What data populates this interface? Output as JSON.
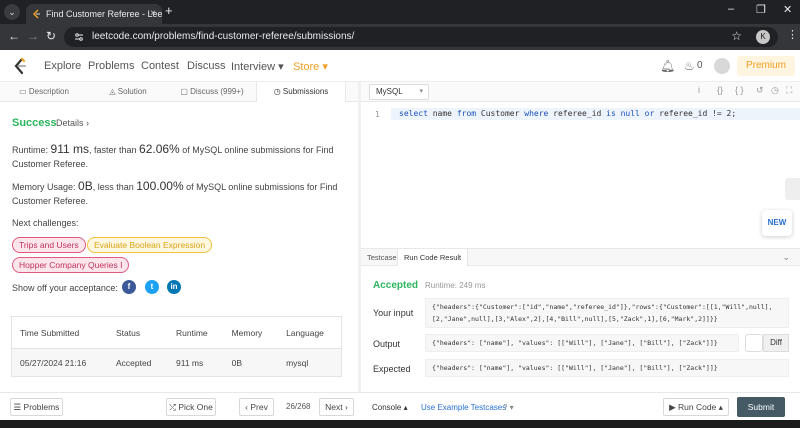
{
  "browser": {
    "tab_title": "Find Customer Referee - LeetC",
    "tab_close": "×",
    "new_tab": "+",
    "url": "leetcode.com/problems/find-customer-referee/submissions/",
    "profile_initial": "K"
  },
  "nav": {
    "links": [
      "Explore",
      "Problems",
      "Contest",
      "Discuss",
      "Interview ▾",
      "Store ▾"
    ],
    "notification_count": "0",
    "premium": "Premium"
  },
  "left_tabs": [
    "Description",
    "Solution",
    "Discuss (999+)",
    "Submissions"
  ],
  "left_tab_icons": [
    "▭",
    "◬",
    "▢",
    "◷"
  ],
  "submission": {
    "status": "Success",
    "details": "Details ›",
    "runtime_prefix": "Runtime: ",
    "runtime_value": "911 ms",
    "runtime_mid": ", faster than ",
    "runtime_pct": "62.06%",
    "runtime_suffix": " of MySQL online submissions for Find Customer Referee.",
    "memory_prefix": "Memory Usage: ",
    "memory_value": "0B",
    "memory_mid": ", less than ",
    "memory_pct": "100.00%",
    "memory_suffix": " of MySQL online submissions for Find Customer Referee.",
    "next_label": "Next challenges:",
    "challenges": [
      "Trips and Users",
      "Evaluate Boolean Expression",
      "Hopper Company Queries I"
    ],
    "show_off": "Show off your acceptance:",
    "social": [
      "f",
      "t",
      "in"
    ]
  },
  "table": {
    "headers": [
      "Time Submitted",
      "Status",
      "Runtime",
      "Memory",
      "Language"
    ],
    "rows": [
      [
        "05/27/2024 21:16",
        "Accepted",
        "911 ms",
        "0B",
        "mysql"
      ]
    ]
  },
  "editor": {
    "language": "MySQL",
    "dropdown_icon": "▾",
    "line_number": "1",
    "code_parts": {
      "k1": "select",
      "t1": " name ",
      "k2": "from",
      "t2": " Customer ",
      "k3": "where",
      "t3": " referee_id ",
      "k4": "is null or",
      "t4": " referee_id != 2;"
    },
    "new_badge": "NEW",
    "toolbar_icons": [
      "i",
      "{}",
      "{ }",
      "↺",
      "◷",
      "⛶"
    ]
  },
  "result_tabs": [
    "Testcase",
    "Run Code Result"
  ],
  "result_close": "⌄",
  "result": {
    "status": "Accepted",
    "runtime": "Runtime: 249 ms",
    "input_label": "Your input",
    "input_value": "{\"headers\":{\"Customer\":[\"id\",\"name\",\"referee_id\"]},\"rows\":{\"Customer\":[[1,\"Will\",null],\n[2,\"Jane\",null],[3,\"Alex\",2],[4,\"Bill\",null],[5,\"Zack\",1],[6,\"Mark\",2]]}}",
    "output_label": "Output",
    "output_value": "{\"headers\": [\"name\"], \"values\": [[\"Will\"], [\"Jane\"], [\"Bill\"], [\"Zack\"]]}",
    "diff": "Diff",
    "expected_label": "Expected",
    "expected_value": "{\"headers\": [\"name\"], \"values\": [[\"Will\"], [\"Jane\"], [\"Bill\"], [\"Zack\"]]}"
  },
  "footer": {
    "problems": "☰ Problems",
    "pick_one": "⤮ Pick One",
    "prev": "‹ Prev",
    "page": "26/268",
    "next": "Next ›",
    "console": "Console ▴",
    "use_example": "Use Example Testcases",
    "help": "? ▾",
    "run_code": "▶ Run Code ▴",
    "submit": "Submit"
  },
  "colors": {
    "success": "#2db55d",
    "store": "#f0a020",
    "submit_bg": "#455a64",
    "chip_red": "#e05a7f",
    "chip_yellow": "#f0c040",
    "facebook": "#3b5998",
    "twitter": "#1da1f2",
    "linkedin": "#0077b5"
  }
}
